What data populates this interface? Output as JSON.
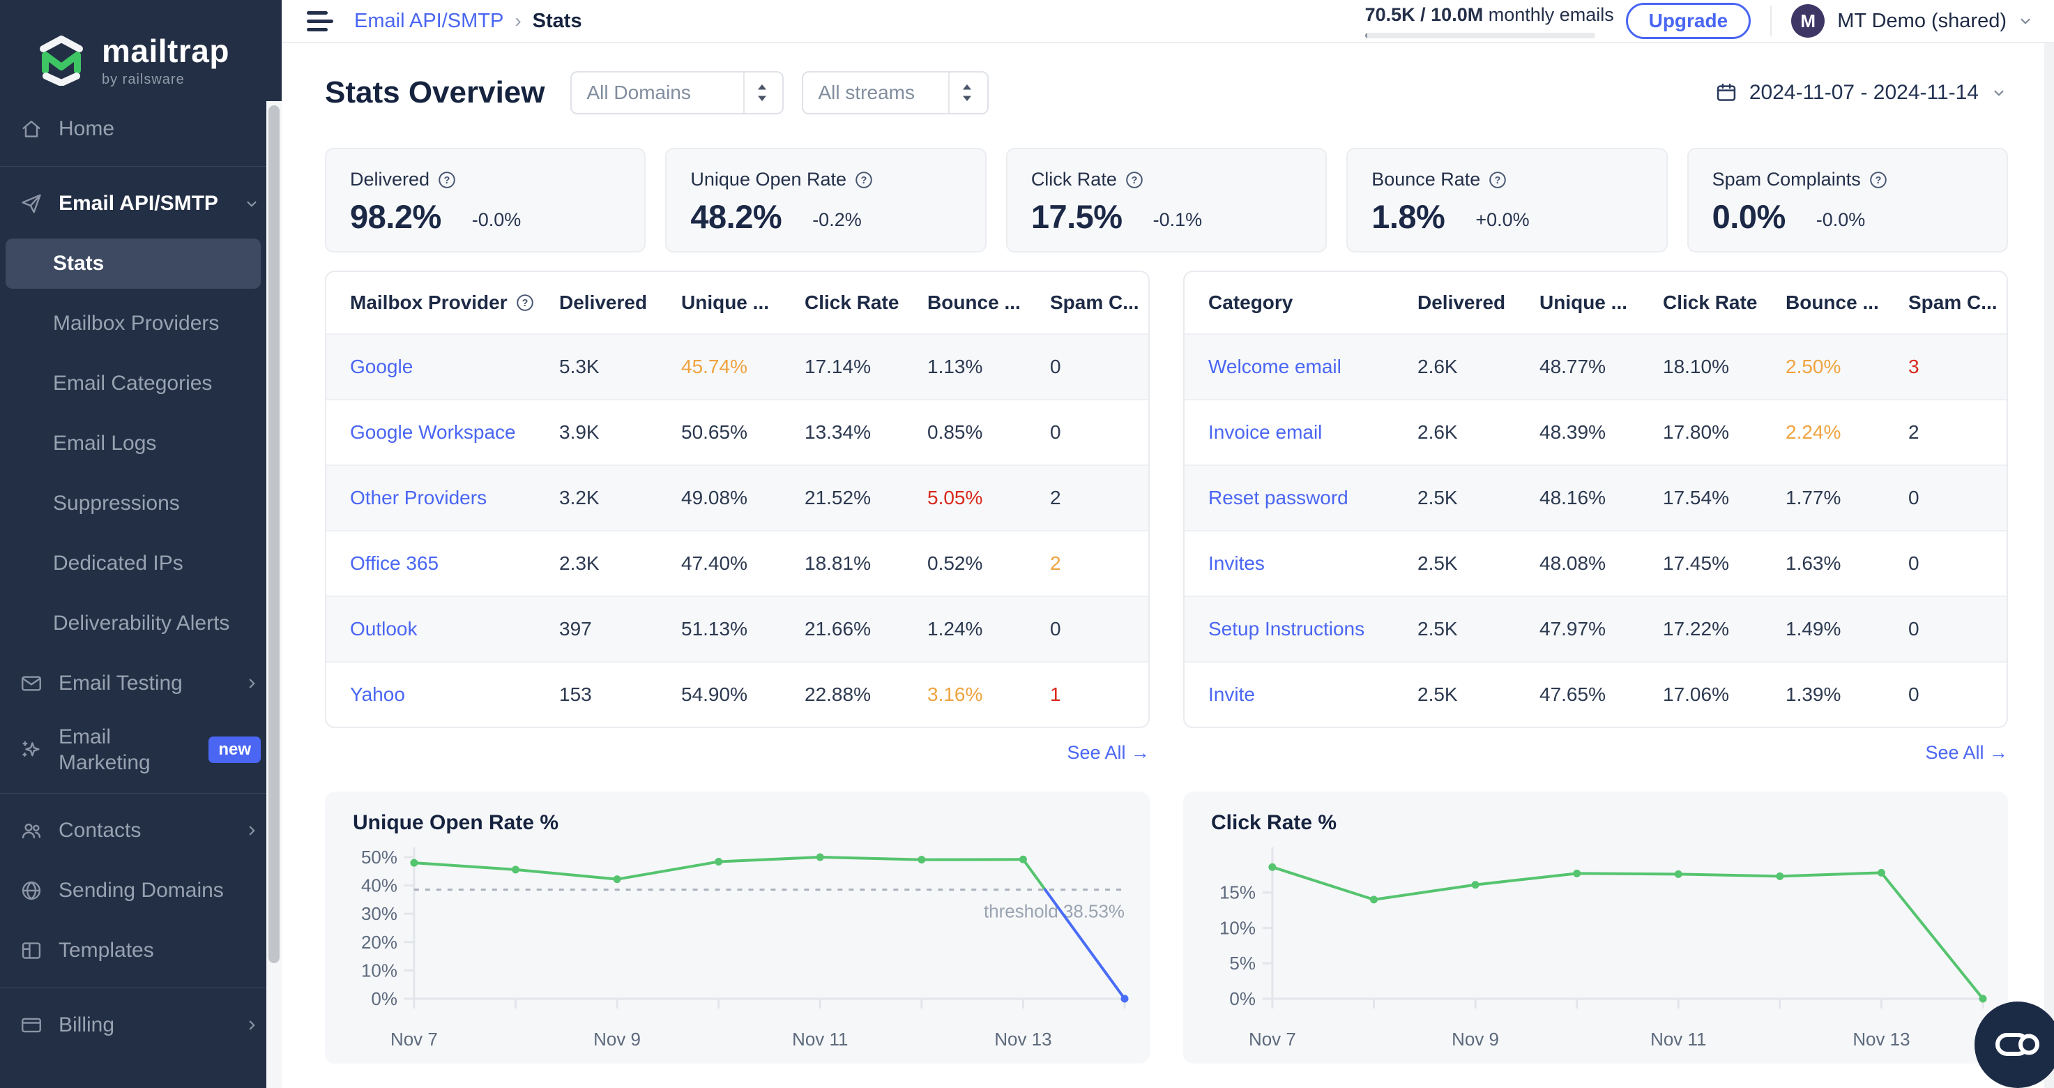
{
  "topbar": {
    "breadcrumb": {
      "parent": "Email API/SMTP",
      "separator": "›",
      "current": "Stats"
    },
    "usage_bold": "70.5K / 10.0M",
    "usage_rest": " monthly emails",
    "upgrade_label": "Upgrade",
    "account_initial": "M",
    "account_name": "MT Demo (shared)"
  },
  "sidebar": {
    "logo_title": "mailtrap",
    "logo_subtitle": "by railsware",
    "items": [
      {
        "id": "home",
        "label": "Home",
        "icon": "home-icon",
        "type": "item"
      },
      {
        "type": "divider"
      },
      {
        "id": "email-api-smtp",
        "label": "Email API/SMTP",
        "icon": "send-icon",
        "type": "section",
        "chevron": "down"
      },
      {
        "id": "stats",
        "label": "Stats",
        "type": "sub",
        "active": true
      },
      {
        "id": "mailbox-providers",
        "label": "Mailbox Providers",
        "type": "sub"
      },
      {
        "id": "email-categories",
        "label": "Email Categories",
        "type": "sub"
      },
      {
        "id": "email-logs",
        "label": "Email Logs",
        "type": "sub"
      },
      {
        "id": "suppressions",
        "label": "Suppressions",
        "type": "sub"
      },
      {
        "id": "dedicated-ips",
        "label": "Dedicated IPs",
        "type": "sub"
      },
      {
        "id": "deliverability-alerts",
        "label": "Deliverability Alerts",
        "type": "sub"
      },
      {
        "id": "email-testing",
        "label": "Email Testing",
        "icon": "email-testing-icon",
        "type": "item",
        "chevron": "right"
      },
      {
        "id": "email-marketing",
        "label": "Email Marketing",
        "icon": "sparkles-icon",
        "type": "item",
        "badge": "new",
        "twoline": true
      },
      {
        "type": "divider"
      },
      {
        "id": "contacts",
        "label": "Contacts",
        "icon": "contacts-icon",
        "type": "item",
        "chevron": "right"
      },
      {
        "id": "sending-domains",
        "label": "Sending Domains",
        "icon": "globe-icon",
        "type": "item"
      },
      {
        "id": "templates",
        "label": "Templates",
        "icon": "templates-icon",
        "type": "item"
      },
      {
        "type": "divider"
      },
      {
        "id": "billing",
        "label": "Billing",
        "icon": "billing-icon",
        "type": "item",
        "chevron": "right"
      }
    ]
  },
  "overview": {
    "title": "Stats Overview",
    "domain_filter": "All Domains",
    "stream_filter": "All streams",
    "date_range": "2024-11-07 - 2024-11-14"
  },
  "metric_cards": [
    {
      "label": "Delivered",
      "value": "98.2%",
      "delta": "-0.0%"
    },
    {
      "label": "Unique Open Rate",
      "value": "48.2%",
      "delta": "-0.2%"
    },
    {
      "label": "Click Rate",
      "value": "17.5%",
      "delta": "-0.1%"
    },
    {
      "label": "Bounce Rate",
      "value": "1.8%",
      "delta": "+0.0%"
    },
    {
      "label": "Spam Complaints",
      "value": "0.0%",
      "delta": "-0.0%"
    }
  ],
  "tables": {
    "provider": {
      "headers": [
        "Mailbox Provider",
        "Delivered",
        "Unique ...",
        "Click Rate",
        "Bounce ...",
        "Spam C..."
      ],
      "header_help": true,
      "see_all": "See All →",
      "rows": [
        {
          "cells": [
            "Google",
            "5.3K",
            "45.74%",
            "17.14%",
            "1.13%",
            "0"
          ],
          "styles": [
            "link",
            "plain",
            "orange",
            "plain",
            "plain",
            "plain"
          ]
        },
        {
          "cells": [
            "Google Workspace",
            "3.9K",
            "50.65%",
            "13.34%",
            "0.85%",
            "0"
          ],
          "styles": [
            "link",
            "plain",
            "plain",
            "plain",
            "plain",
            "plain"
          ]
        },
        {
          "cells": [
            "Other Providers",
            "3.2K",
            "49.08%",
            "21.52%",
            "5.05%",
            "2"
          ],
          "styles": [
            "link",
            "plain",
            "plain",
            "plain",
            "red",
            "plain"
          ]
        },
        {
          "cells": [
            "Office 365",
            "2.3K",
            "47.40%",
            "18.81%",
            "0.52%",
            "2"
          ],
          "styles": [
            "link",
            "plain",
            "plain",
            "plain",
            "plain",
            "orange"
          ]
        },
        {
          "cells": [
            "Outlook",
            "397",
            "51.13%",
            "21.66%",
            "1.24%",
            "0"
          ],
          "styles": [
            "link",
            "plain",
            "plain",
            "plain",
            "plain",
            "plain"
          ]
        },
        {
          "cells": [
            "Yahoo",
            "153",
            "54.90%",
            "22.88%",
            "3.16%",
            "1"
          ],
          "styles": [
            "link",
            "plain",
            "plain",
            "plain",
            "orange",
            "red"
          ]
        }
      ]
    },
    "category": {
      "headers": [
        "Category",
        "Delivered",
        "Unique ...",
        "Click Rate",
        "Bounce ...",
        "Spam C..."
      ],
      "header_help": false,
      "see_all": "See All →",
      "rows": [
        {
          "cells": [
            "Welcome email",
            "2.6K",
            "48.77%",
            "18.10%",
            "2.50%",
            "3"
          ],
          "styles": [
            "link",
            "plain",
            "plain",
            "plain",
            "orange",
            "red"
          ]
        },
        {
          "cells": [
            "Invoice email",
            "2.6K",
            "48.39%",
            "17.80%",
            "2.24%",
            "2"
          ],
          "styles": [
            "link",
            "plain",
            "plain",
            "plain",
            "orange",
            "plain"
          ]
        },
        {
          "cells": [
            "Reset password",
            "2.5K",
            "48.16%",
            "17.54%",
            "1.77%",
            "0"
          ],
          "styles": [
            "link",
            "plain",
            "plain",
            "plain",
            "plain",
            "plain"
          ]
        },
        {
          "cells": [
            "Invites",
            "2.5K",
            "48.08%",
            "17.45%",
            "1.63%",
            "0"
          ],
          "styles": [
            "link",
            "plain",
            "plain",
            "plain",
            "plain",
            "plain"
          ]
        },
        {
          "cells": [
            "Setup Instructions",
            "2.5K",
            "47.97%",
            "17.22%",
            "1.49%",
            "0"
          ],
          "styles": [
            "link",
            "plain",
            "plain",
            "plain",
            "plain",
            "plain"
          ]
        },
        {
          "cells": [
            "Invite",
            "2.5K",
            "47.65%",
            "17.06%",
            "1.39%",
            "0"
          ],
          "styles": [
            "link",
            "plain",
            "plain",
            "plain",
            "plain",
            "plain"
          ]
        }
      ]
    }
  },
  "chart_data": [
    {
      "type": "line",
      "title": "Unique Open Rate %",
      "x": [
        "Nov 7",
        "Nov 8",
        "Nov 9",
        "Nov 10",
        "Nov 11",
        "Nov 12",
        "Nov 13",
        "Nov 14"
      ],
      "x_label_indices": [
        0,
        2,
        4,
        6
      ],
      "series": [
        {
          "name": "Unique Open Rate",
          "values": [
            48.0,
            45.6,
            42.2,
            48.4,
            50.0,
            49.1,
            49.2,
            0.0
          ],
          "color": "#55c46f"
        }
      ],
      "threshold": {
        "value": 38.53,
        "label": "threshold 38.53%",
        "color": "#aab1bb"
      },
      "below_threshold_color": "#4a6cf7",
      "ylim": [
        0,
        50
      ],
      "yticks": [
        0,
        10,
        20,
        30,
        40,
        50
      ],
      "grid": false,
      "legend": "none"
    },
    {
      "type": "line",
      "title": "Click Rate %",
      "x": [
        "Nov 7",
        "Nov 8",
        "Nov 9",
        "Nov 10",
        "Nov 11",
        "Nov 12",
        "Nov 13",
        "Nov 14"
      ],
      "x_label_indices": [
        0,
        2,
        4,
        6
      ],
      "series": [
        {
          "name": "Click Rate",
          "values": [
            18.6,
            14.0,
            16.1,
            17.7,
            17.6,
            17.3,
            17.8,
            0.0
          ],
          "color": "#55c46f"
        }
      ],
      "ylim": [
        0,
        20
      ],
      "yticks": [
        0,
        5,
        10,
        15
      ],
      "grid": false,
      "legend": "none"
    }
  ],
  "colors": {
    "accent_blue": "#4a66f3",
    "orange": "#efa33f",
    "red": "#d7281c",
    "green": "#55c46f",
    "sidebar_bg": "#232f45"
  }
}
